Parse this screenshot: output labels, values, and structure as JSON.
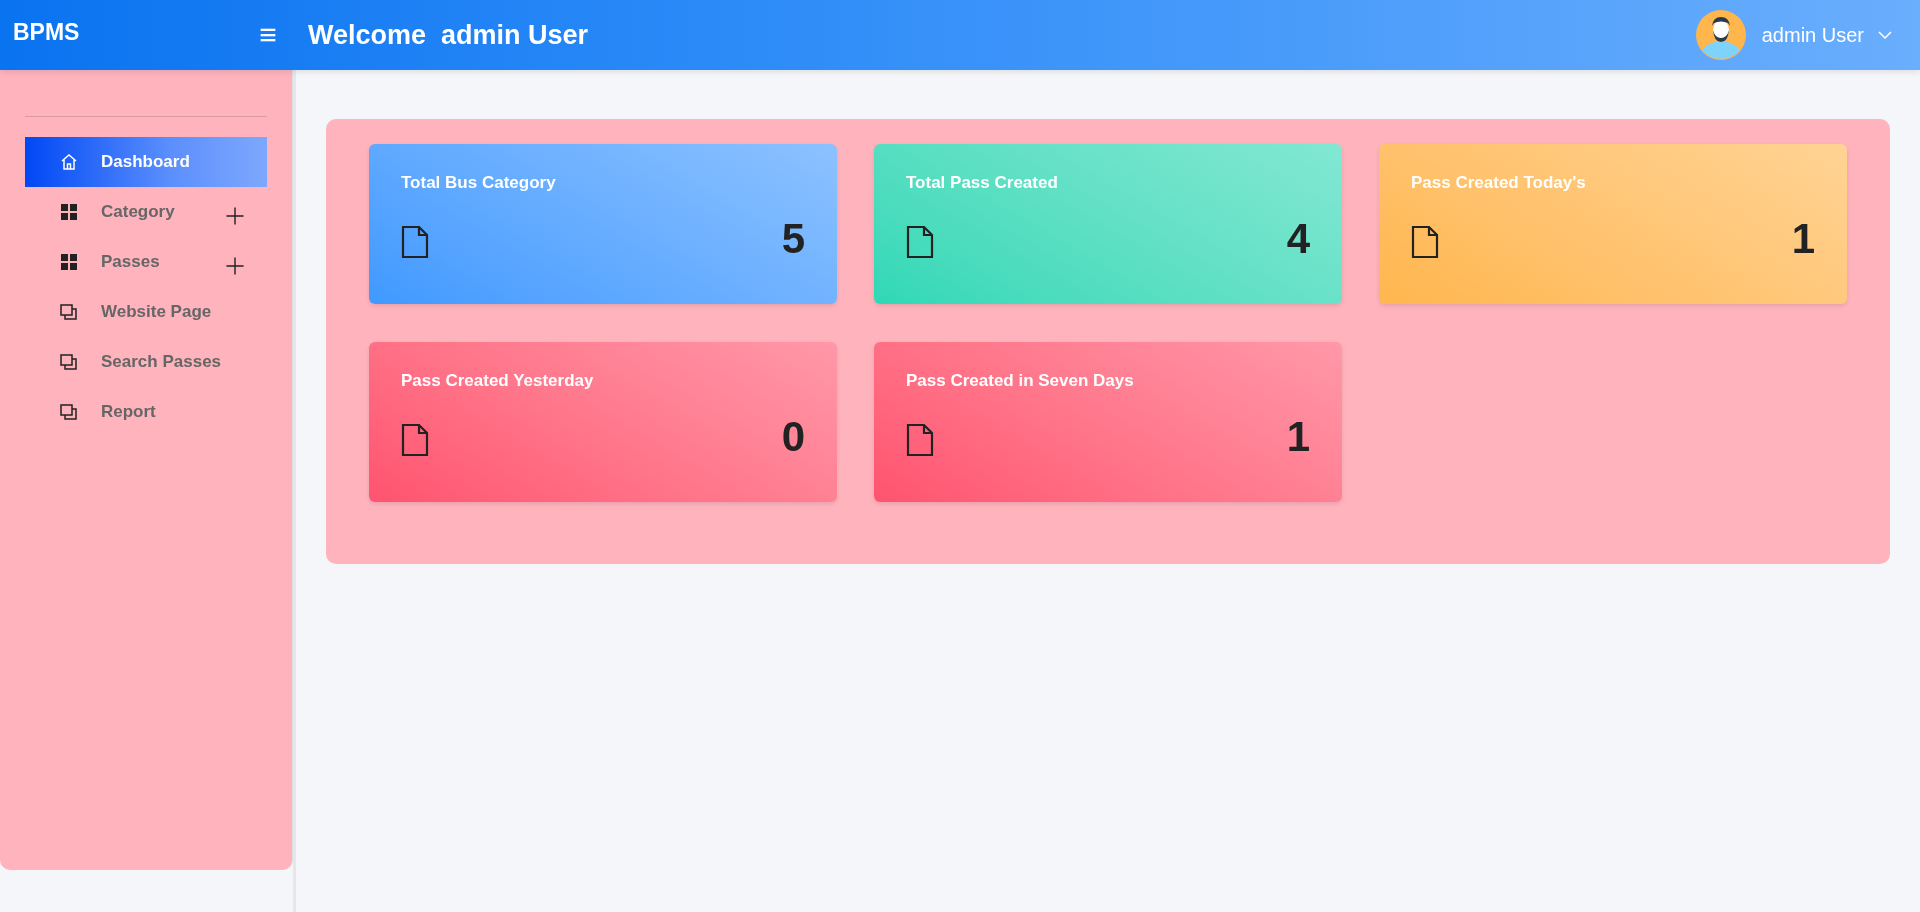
{
  "header": {
    "brand": "BPMS",
    "menu_icon": "≡",
    "welcome": "Welcome  admin User",
    "user_name": "admin User"
  },
  "sidebar": {
    "items": [
      {
        "label": "Dashboard",
        "kind": "home",
        "selected": true,
        "expandable": false
      },
      {
        "label": "Category",
        "kind": "grid",
        "selected": false,
        "expandable": true
      },
      {
        "label": "Passes",
        "kind": "grid",
        "selected": false,
        "expandable": true
      },
      {
        "label": "Website Page",
        "kind": "windows",
        "selected": false,
        "expandable": false
      },
      {
        "label": "Search Passes",
        "kind": "windows",
        "selected": false,
        "expandable": false
      },
      {
        "label": "Report",
        "kind": "windows",
        "selected": false,
        "expandable": false
      }
    ]
  },
  "cards": [
    {
      "title": "Total Bus Category",
      "value": "5",
      "color": "#4099ff"
    },
    {
      "title": "Total Pass Created",
      "value": "4",
      "color": "#2ed8b6"
    },
    {
      "title": "Pass Created Today's",
      "value": "1",
      "color": "#ffb64d"
    },
    {
      "title": "Pass Created Yesterday",
      "value": "0",
      "color": "#ff5370"
    },
    {
      "title": "Pass Created in Seven Days",
      "value": "1",
      "color": "#ff5370"
    }
  ]
}
